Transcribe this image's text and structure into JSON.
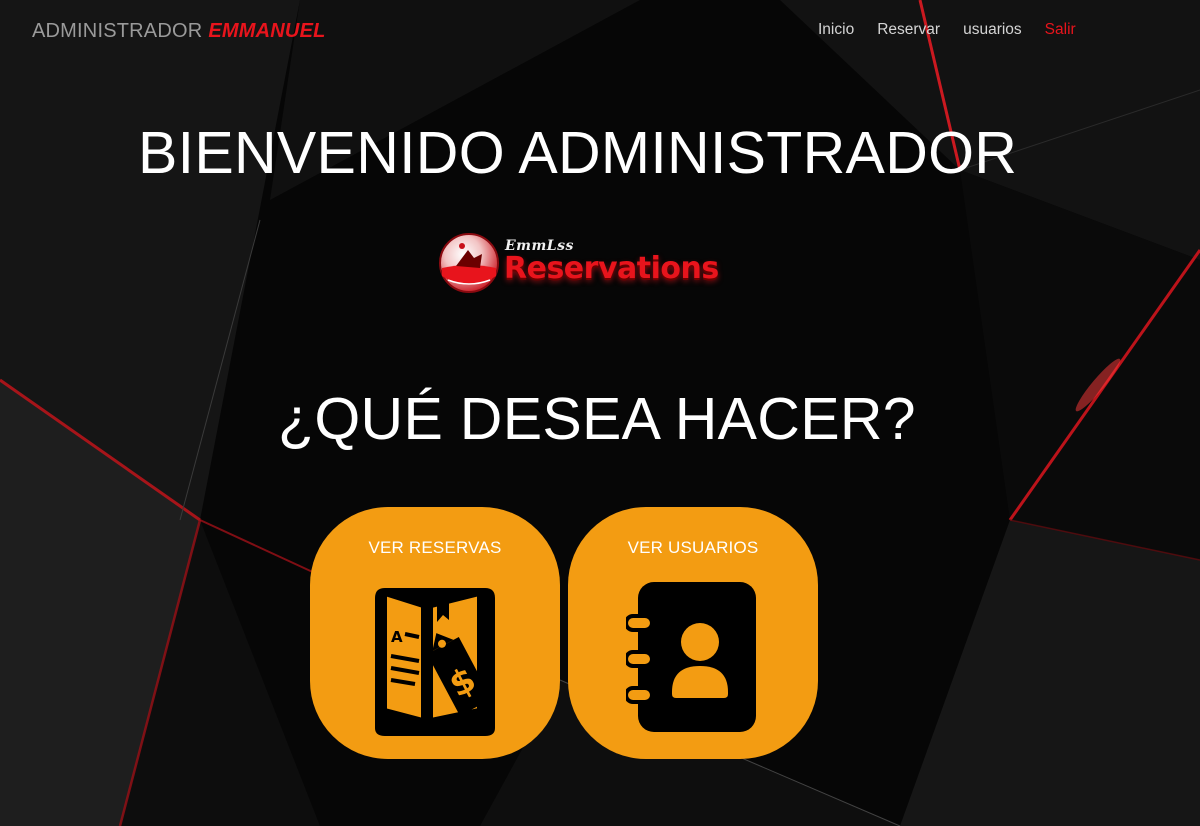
{
  "navbar": {
    "brand_role": "ADMINISTRADOR",
    "brand_user": "EMMANUEL",
    "links": [
      {
        "label": "Inicio"
      },
      {
        "label": "Reservar"
      },
      {
        "label": "usuarios"
      },
      {
        "label": "Salir"
      }
    ]
  },
  "hero": {
    "welcome": "BIENVENIDO ADMINISTRADOR",
    "question": "¿QUÉ DESEA HACER?"
  },
  "logo": {
    "line_small": "EmmLss",
    "line_big": "Reservations"
  },
  "actions": [
    {
      "label": "VER RESERVAS",
      "icon": "menu-price-book-icon"
    },
    {
      "label": "VER USUARIOS",
      "icon": "contact-book-icon"
    }
  ],
  "colors": {
    "accent": "#e8141c",
    "tile": "#f39c12",
    "background": "#050505"
  }
}
